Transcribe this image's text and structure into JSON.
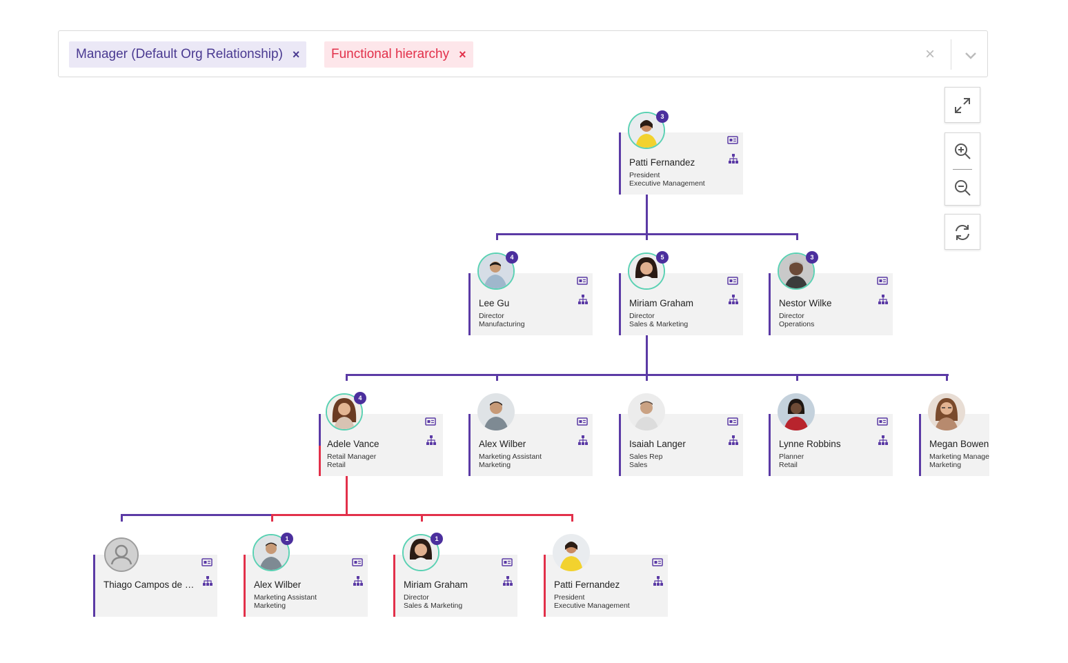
{
  "filters": {
    "chips": [
      {
        "label": "Manager (Default Org Relationship)",
        "color": "#4a3a91"
      },
      {
        "label": "Functional hierarchy",
        "color": "#e2304a"
      }
    ],
    "remove_icon": "×",
    "clear_icon": "×"
  },
  "controls": [
    "expand-icon",
    "zoom-in-icon",
    "zoom-out-icon",
    "refresh-icon"
  ],
  "colors": {
    "manager_line": "#5b3aa5",
    "functional_line": "#e2304a",
    "avatar_ring": "#5ad1b3",
    "badge": "#4b2f9d"
  },
  "org": {
    "root": {
      "name": "Patti Fernandez",
      "title": "President",
      "dept": "Executive Management",
      "reports": "3"
    },
    "level2": [
      {
        "name": "Lee Gu",
        "title": "Director",
        "dept": "Manufacturing",
        "reports": "4"
      },
      {
        "name": "Miriam Graham",
        "title": "Director",
        "dept": "Sales & Marketing",
        "reports": "5"
      },
      {
        "name": "Nestor Wilke",
        "title": "Director",
        "dept": "Operations",
        "reports": "3"
      }
    ],
    "level3": [
      {
        "name": "Adele Vance",
        "title": "Retail Manager",
        "dept": "Retail",
        "reports": "4"
      },
      {
        "name": "Alex Wilber",
        "title": "Marketing Assistant",
        "dept": "Marketing"
      },
      {
        "name": "Isaiah Langer",
        "title": "Sales Rep",
        "dept": "Sales"
      },
      {
        "name": "Lynne Robbins",
        "title": "Planner",
        "dept": "Retail"
      },
      {
        "name": "Megan Bowen",
        "title": "Marketing Manager",
        "dept": "Marketing"
      }
    ],
    "level4": [
      {
        "name": "Thiago Campos de Oliv..."
      },
      {
        "name": "Alex Wilber",
        "title": "Marketing Assistant",
        "dept": "Marketing",
        "reports": "1"
      },
      {
        "name": "Miriam Graham",
        "title": "Director",
        "dept": "Sales & Marketing",
        "reports": "1"
      },
      {
        "name": "Patti Fernandez",
        "title": "President",
        "dept": "Executive Management"
      }
    ]
  }
}
